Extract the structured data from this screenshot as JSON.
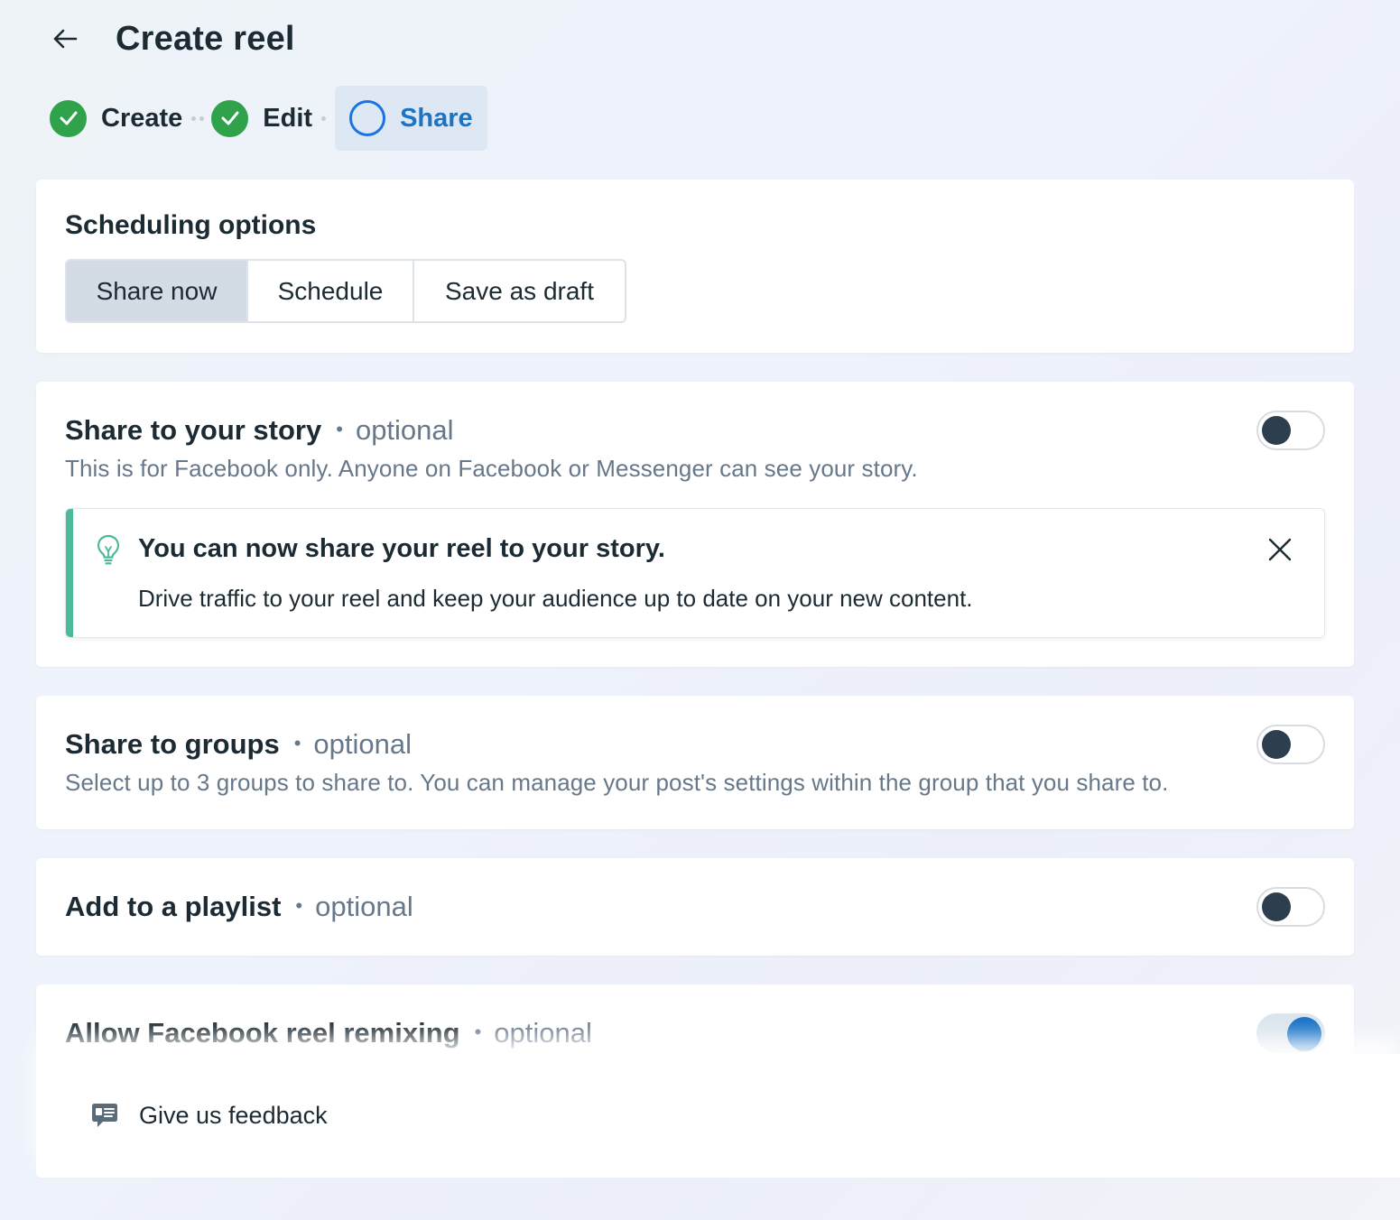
{
  "header": {
    "title": "Create reel",
    "back_icon": "arrow-left-icon"
  },
  "stepper": {
    "steps": [
      {
        "label": "Create",
        "status": "complete"
      },
      {
        "label": "Edit",
        "status": "complete"
      },
      {
        "label": "Share",
        "status": "current"
      }
    ]
  },
  "scheduling": {
    "title": "Scheduling options",
    "options": [
      "Share now",
      "Schedule",
      "Save as draft"
    ],
    "selected": "Share now"
  },
  "story": {
    "title": "Share to your story",
    "optional": "optional",
    "description": "This is for Facebook only. Anyone on Facebook or Messenger can see your story.",
    "enabled": false,
    "tip": {
      "title": "You can now share your reel to your story.",
      "body": "Drive traffic to your reel and keep your audience up to date on your new content."
    }
  },
  "groups": {
    "title": "Share to groups",
    "optional": "optional",
    "description": "Select up to 3 groups to share to. You can manage your post's settings within the group that you share to.",
    "enabled": false
  },
  "playlist": {
    "title": "Add to a playlist",
    "optional": "optional",
    "enabled": false
  },
  "remixing": {
    "title": "Allow Facebook reel remixing",
    "optional": "optional",
    "enabled": true
  },
  "footer": {
    "feedback_label": "Give us feedback"
  },
  "colors": {
    "complete": "#31a24c",
    "accent": "#1b74e4",
    "tip_bar": "#4bb99b",
    "toggle_on": "#1672c8",
    "toggle_off_knob": "#2d3f4e"
  }
}
